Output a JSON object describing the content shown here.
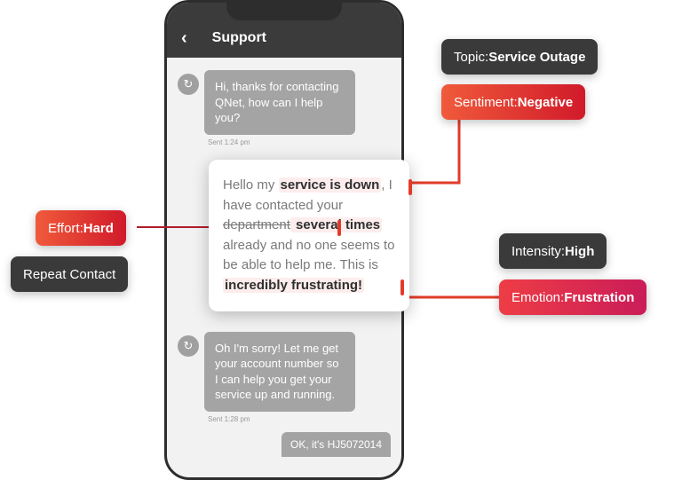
{
  "header": {
    "title": "Support"
  },
  "messages": {
    "agent1": "Hi, thanks for contacting QNet, how can I help you?",
    "agent1_ts": "Sent 1:24 pm",
    "user_big": {
      "p1a": "Hello my ",
      "p1b": "service is down",
      "p2a": ", I have contacted your ",
      "p2b": "department",
      "p2c": " several times",
      "p3": " already and no one seems to be able to help me. This is ",
      "p4": "incredibly frustrating!"
    },
    "agent2": "Oh I'm sorry! Let me get your account number so I can help you get your service up and running.",
    "agent2_ts": "Sent 1:28 pm",
    "user2": "OK, it's HJ5072014"
  },
  "labels": {
    "topic_k": "Topic: ",
    "topic_v": "Service Outage",
    "sentiment_k": "Sentiment: ",
    "sentiment_v": "Negative",
    "effort_k": "Effort: ",
    "effort_v": "Hard",
    "repeat": "Repeat Contact",
    "intensity_k": "Intensity: ",
    "intensity_v": "High",
    "emotion_k": "Emotion: ",
    "emotion_v": "Frustration"
  }
}
